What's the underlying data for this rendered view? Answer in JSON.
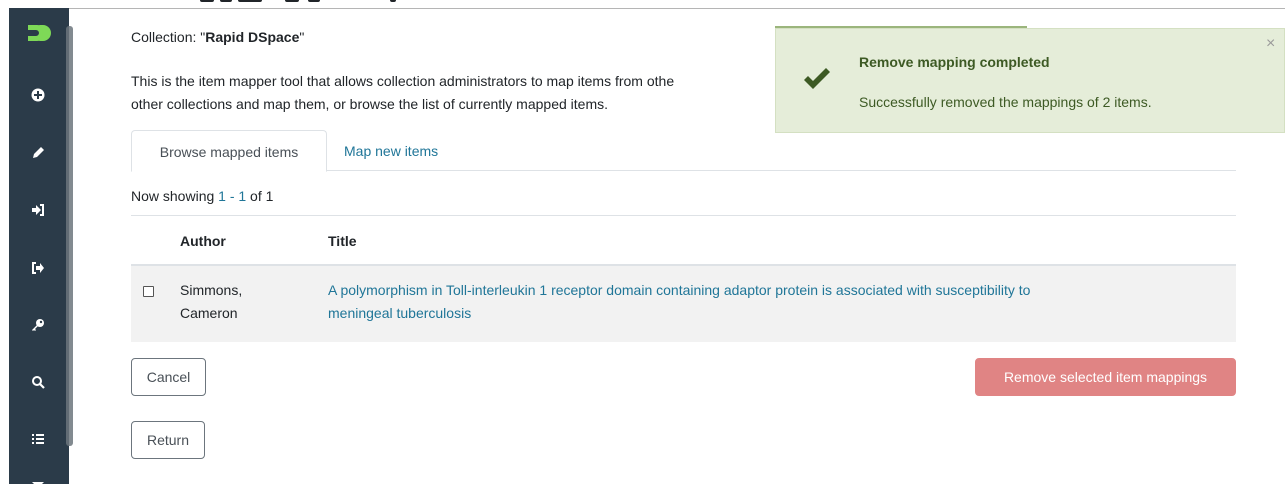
{
  "collection": {
    "prefix": "Collection: \"",
    "name": "Rapid DSpace",
    "suffix": "\""
  },
  "intro": {
    "line1": "This is the item mapper tool that allows collection administrators to map items from othe",
    "line2": "other collections and map them, or browse the list of currently mapped items."
  },
  "tabs": [
    {
      "label": "Browse mapped items",
      "active": true
    },
    {
      "label": "Map new items",
      "active": false
    }
  ],
  "showing": {
    "prefix": "Now showing ",
    "range": "1 - 1",
    "suffix": " of 1"
  },
  "table": {
    "headers": {
      "author": "Author",
      "title": "Title"
    },
    "rows": [
      {
        "author_line1": "Simmons,",
        "author_line2": "Cameron",
        "title_line1": "A polymorphism in Toll-interleukin 1 receptor domain containing adaptor protein is associated with susceptibility to",
        "title_line2": "meningeal tuberculosis"
      }
    ]
  },
  "buttons": {
    "cancel": "Cancel",
    "remove": "Remove selected item mappings",
    "return": "Return"
  },
  "toast": {
    "title": "Remove mapping completed",
    "message": "Successfully removed the mappings of 2 items.",
    "close": "×"
  },
  "sidebar": {
    "icons": [
      "dspace-logo-icon",
      "plus-circle-icon",
      "pencil-icon",
      "sign-in-icon",
      "sign-out-icon",
      "key-icon",
      "search-icon",
      "list-icon",
      "caret-down-icon"
    ]
  },
  "colors": {
    "sidebar": "#2b3b49",
    "link": "#207698",
    "danger": "#e08484",
    "toast_bg": "#e5edd9",
    "toast_text": "#3d5a24"
  }
}
